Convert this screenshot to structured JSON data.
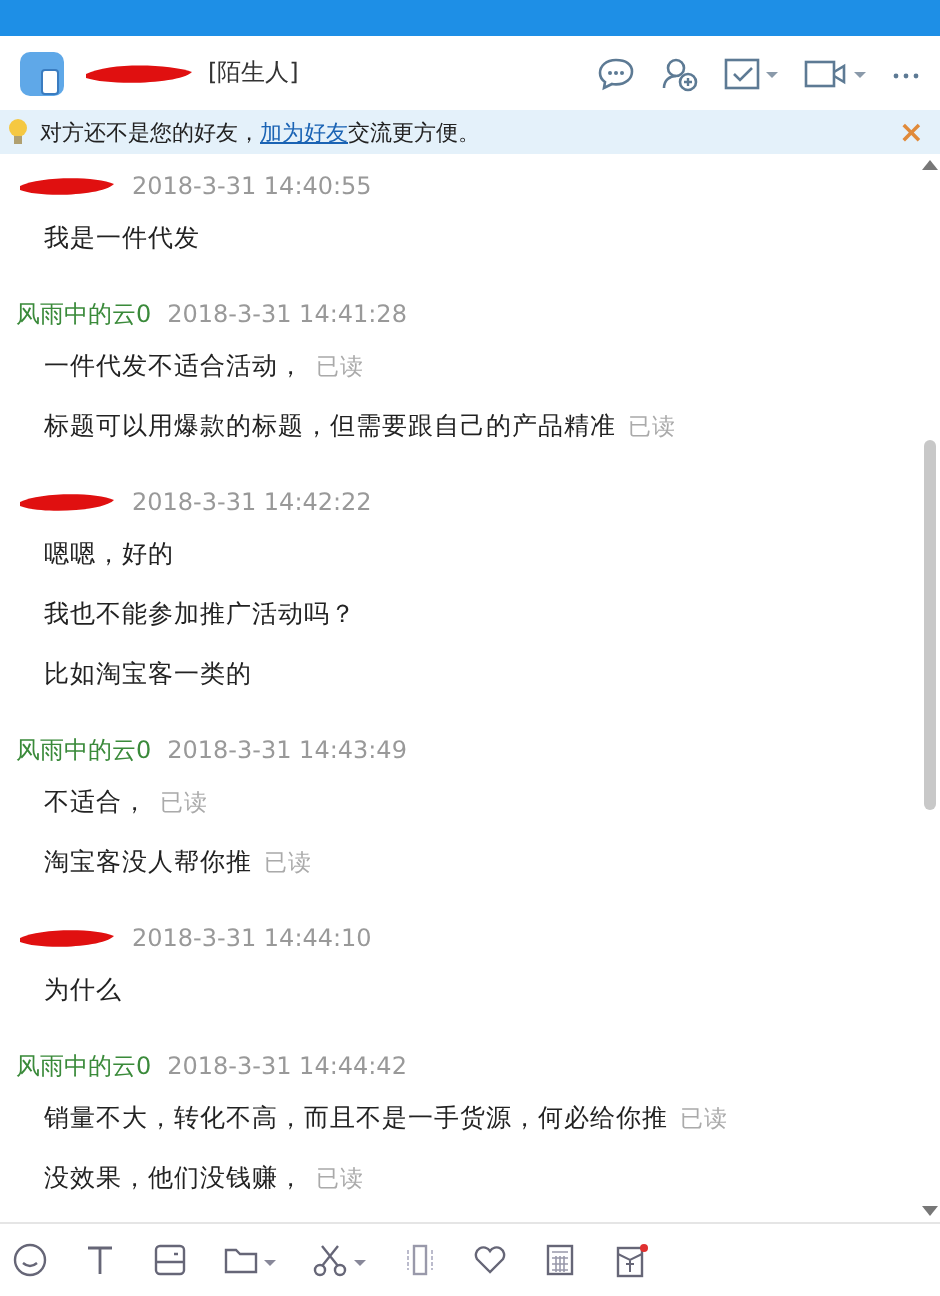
{
  "header": {
    "tag": "[陌生人]"
  },
  "notice": {
    "before": "对方还不是您的好友，",
    "link": "加为好友",
    "after": "交流更方便。",
    "close": "×"
  },
  "messages": [
    {
      "sender": {
        "kind": "redacted"
      },
      "time": "2018-3-31 14:40:55",
      "lines": [
        {
          "text": "我是一件代发"
        }
      ]
    },
    {
      "sender": {
        "kind": "self",
        "name": "风雨中的云0"
      },
      "time": "2018-3-31 14:41:28",
      "lines": [
        {
          "text": "一件代发不适合活动，",
          "receipt": "已读"
        },
        {
          "text": "标题可以用爆款的标题，但需要跟自己的产品精准",
          "receipt": "已读"
        }
      ]
    },
    {
      "sender": {
        "kind": "redacted"
      },
      "time": "2018-3-31 14:42:22",
      "lines": [
        {
          "text": "嗯嗯，好的"
        },
        {
          "text": "我也不能参加推广活动吗？"
        },
        {
          "text": "比如淘宝客一类的"
        }
      ]
    },
    {
      "sender": {
        "kind": "self",
        "name": "风雨中的云0"
      },
      "time": "2018-3-31 14:43:49",
      "lines": [
        {
          "text": "不适合，",
          "receipt": "已读"
        },
        {
          "text": "淘宝客没人帮你推",
          "receipt": "已读"
        }
      ]
    },
    {
      "sender": {
        "kind": "redacted"
      },
      "time": "2018-3-31 14:44:10",
      "lines": [
        {
          "text": "为什么"
        }
      ]
    },
    {
      "sender": {
        "kind": "self",
        "name": "风雨中的云0"
      },
      "time": "2018-3-31 14:44:42",
      "lines": [
        {
          "text": "销量不大，转化不高，而且不是一手货源，何必给你推",
          "receipt": "已读"
        },
        {
          "text": "没效果，他们没钱赚，",
          "receipt": "已读"
        }
      ]
    }
  ]
}
